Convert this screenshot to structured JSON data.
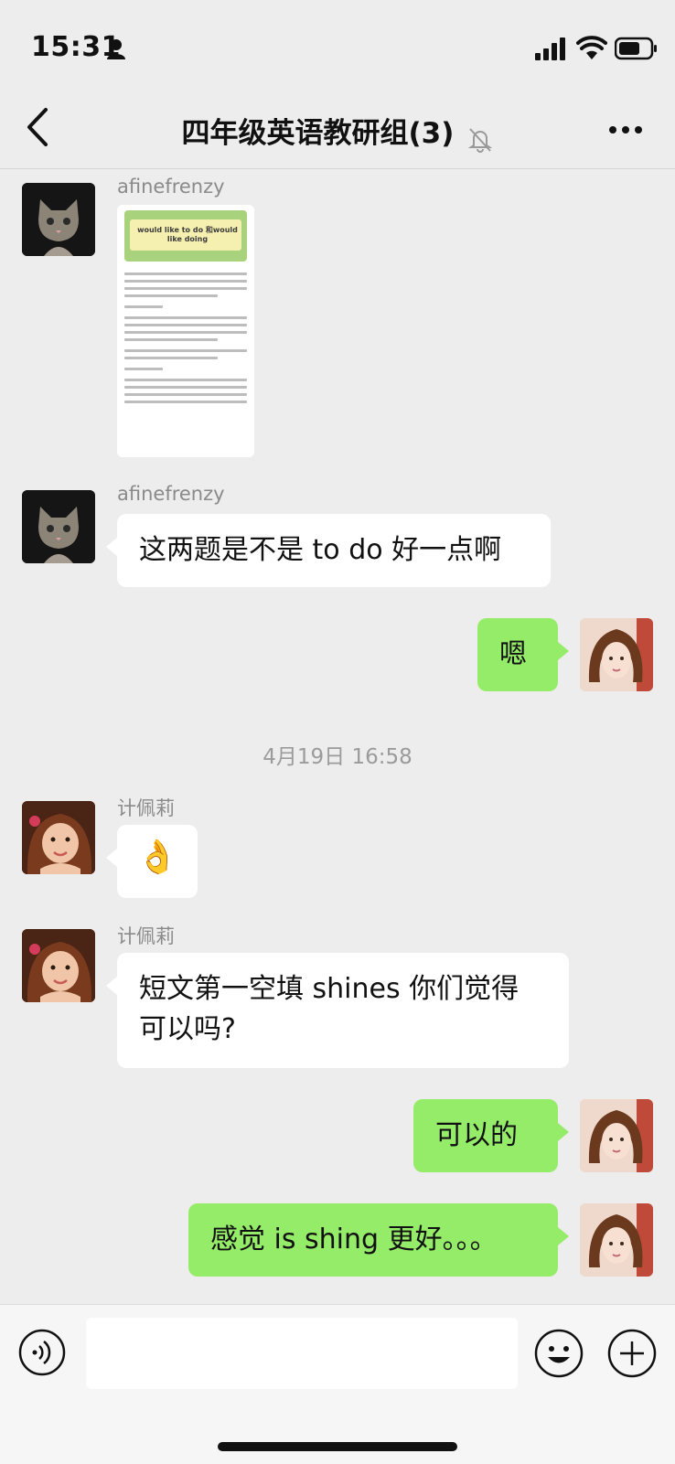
{
  "status": {
    "time": "15:31"
  },
  "nav": {
    "title": "四年级英语教研组(3)"
  },
  "messages": [
    {
      "sender": "afinefrenzy",
      "type": "image",
      "image_heading": "would like to do 和would like doing"
    },
    {
      "sender": "afinefrenzy",
      "type": "text",
      "text": "这两题是不是 to do 好一点啊"
    },
    {
      "sender": "me",
      "type": "text",
      "text": "嗯"
    },
    {
      "type": "timestamp",
      "text": "4月19日 16:58"
    },
    {
      "sender": "计佩莉",
      "type": "emoji",
      "text": "👌"
    },
    {
      "sender": "计佩莉",
      "type": "text",
      "line1": "短文第一空填 shines 你们觉得",
      "line2": "可以吗?"
    },
    {
      "sender": "me",
      "type": "text",
      "text": "可以的"
    },
    {
      "sender": "me",
      "type": "text",
      "text": "感觉 is shing 更好。。。"
    }
  ],
  "colors": {
    "incoming": "#ffffff",
    "outgoing": "#95ec69",
    "background": "#ededed"
  }
}
